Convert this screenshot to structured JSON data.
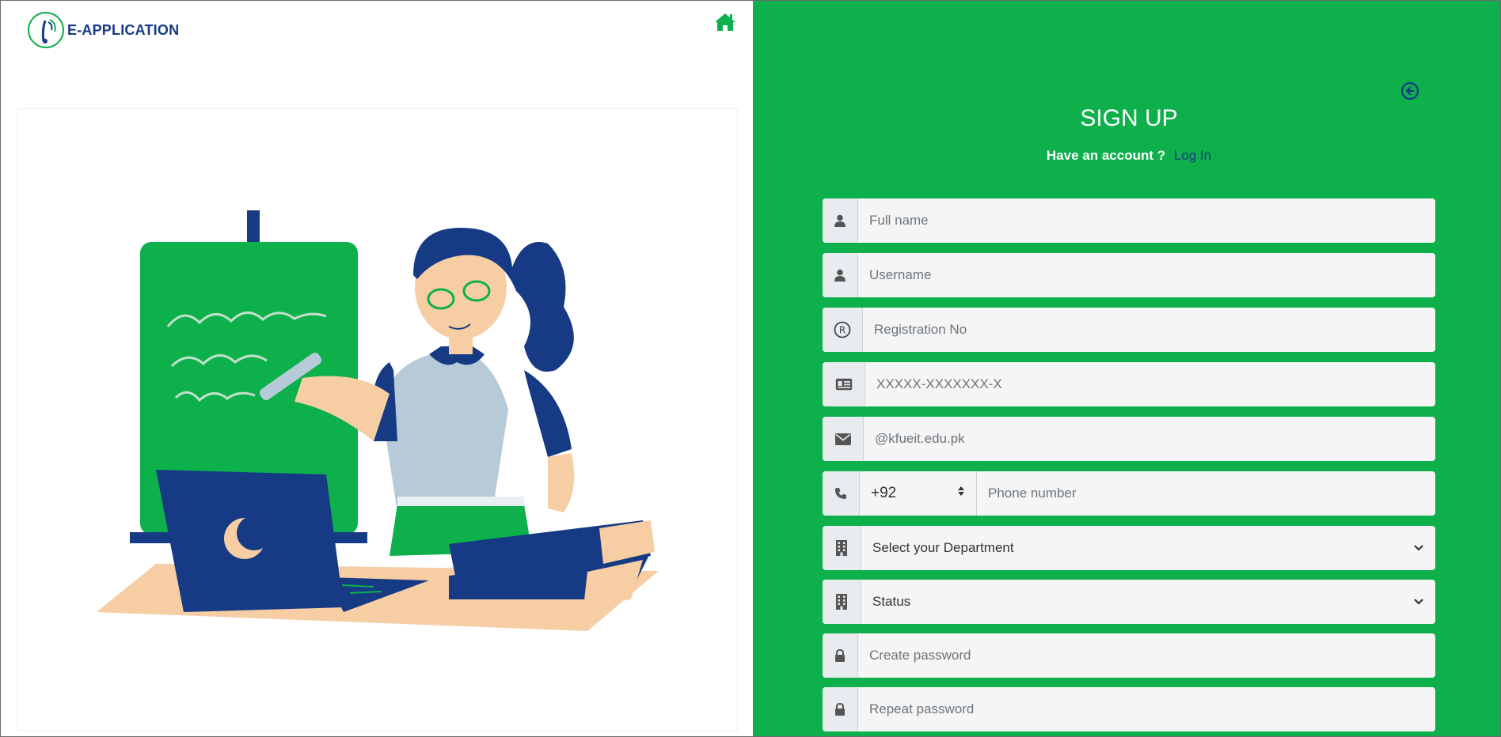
{
  "header": {
    "logo_text": "E-APPLICATION",
    "home_icon": "home-icon"
  },
  "form": {
    "title": "SIGN UP",
    "account_prompt": "Have an account ?",
    "login_link": "Log In",
    "back_icon": "back-arrow-circle-icon",
    "full_name_placeholder": "Full name",
    "username_placeholder": "Username",
    "registration_placeholder": "Registration No",
    "cnic_placeholder": "XXXXX-XXXXXXX-X",
    "email_placeholder": "@kfueit.edu.pk",
    "country_code": "+92",
    "phone_placeholder": "Phone number",
    "department_selected": "Select your Department",
    "status_selected": "Status",
    "create_password_placeholder": "Create password",
    "repeat_password_placeholder": "Repeat password"
  },
  "colors": {
    "brand_green": "#0db04b",
    "brand_navy": "#163a84",
    "skin": "#f7cda4",
    "sweater": "#b7cad7"
  }
}
